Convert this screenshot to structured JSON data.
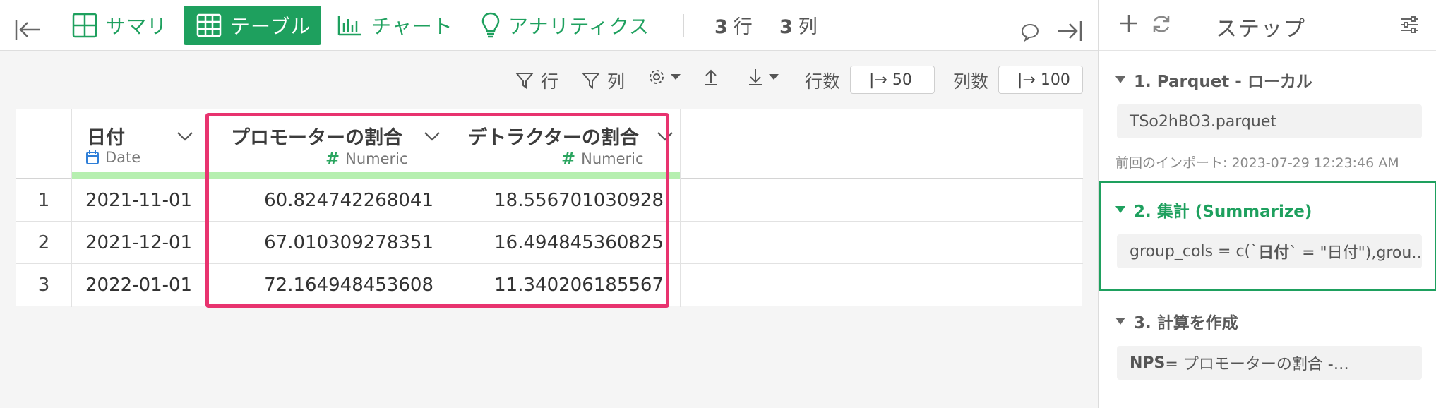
{
  "toolbar": {
    "summary_label": "サマリ",
    "table_label": "テーブル",
    "chart_label": "チャート",
    "analytics_label": "アナリティクス",
    "row_count": "3",
    "row_unit": "行",
    "col_count": "3",
    "col_unit": "列",
    "accent_color": "#1ea05e"
  },
  "subbar": {
    "filter_row_label": "行",
    "filter_col_label": "列",
    "rows_label": "行数",
    "rows_value": "|→ 50",
    "cols_label": "列数",
    "cols_value": "|→ 100"
  },
  "table": {
    "columns": [
      {
        "name": "日付",
        "type": "Date",
        "type_icon": "calendar-icon"
      },
      {
        "name": "プロモーターの割合",
        "type": "Numeric",
        "type_icon": "hash-icon"
      },
      {
        "name": "デトラクターの割合",
        "type": "Numeric",
        "type_icon": "hash-icon"
      }
    ],
    "rows": [
      {
        "index": "1",
        "date": "2021-11-01",
        "promoter": "60.824742268041",
        "detractor": "18.556701030928"
      },
      {
        "index": "2",
        "date": "2021-12-01",
        "promoter": "67.010309278351",
        "detractor": "16.494845360825"
      },
      {
        "index": "3",
        "date": "2022-01-01",
        "promoter": "72.164948453608",
        "detractor": "11.340206185567"
      }
    ],
    "highlight_color": "#e8336f"
  },
  "panel": {
    "title": "ステップ",
    "steps": [
      {
        "title": "1. Parquet - ローカル",
        "content": "TSo2hBO3.parquet",
        "meta": "前回のインポート: 2023-07-29 12:23:46 AM"
      },
      {
        "title": "2. 集計 (Summarize)",
        "content_prefix": "group_cols = c(`",
        "content_bold": "日付",
        "content_suffix": "` = \"日付\"),grou…"
      },
      {
        "title": "3. 計算を作成",
        "content_bold": "NPS",
        "content_suffix": " = プロモーターの割合 -…"
      }
    ]
  }
}
